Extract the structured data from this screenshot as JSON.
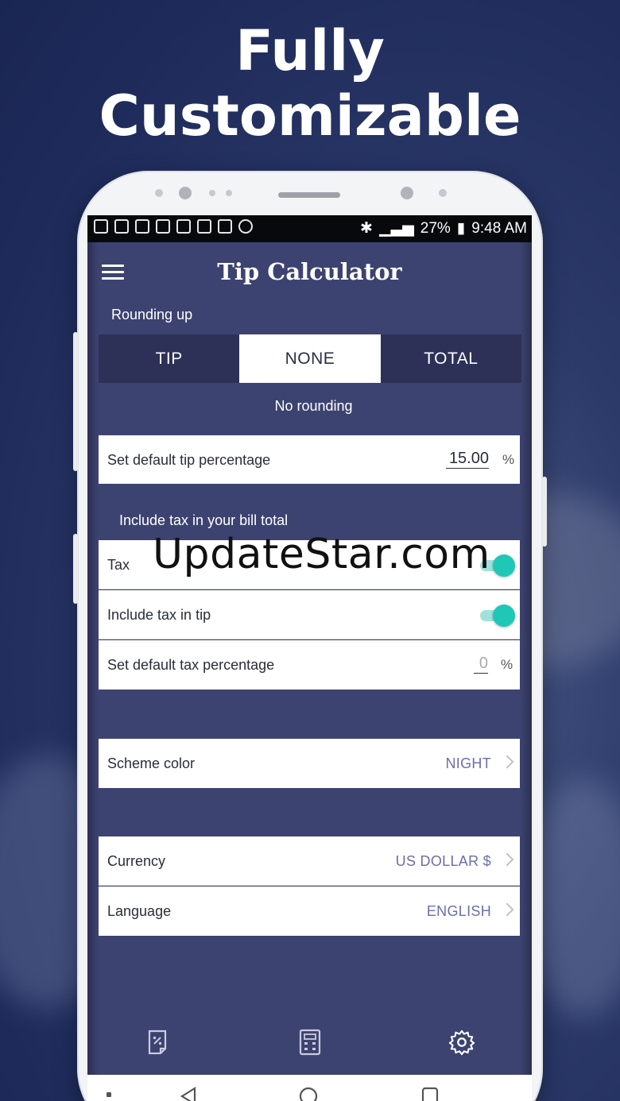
{
  "promo": {
    "headline_line1": "Fully",
    "headline_line2": "Customizable"
  },
  "status_bar": {
    "battery": "27%",
    "time": "9:48 AM"
  },
  "app": {
    "title": "Tip Calculator"
  },
  "rounding": {
    "section_label": "Rounding up",
    "options": [
      "TIP",
      "NONE",
      "TOTAL"
    ],
    "selected": "NONE",
    "note": "No rounding"
  },
  "tip": {
    "label": "Set default tip percentage",
    "value": "15.00",
    "unit": "%"
  },
  "tax_section": {
    "section_label": "Include tax in your bill total",
    "tax_label": "Tax",
    "tax_enabled": true,
    "include_in_tip_label": "Include tax in tip",
    "include_in_tip_enabled": true,
    "default_tax_label": "Set default tax percentage",
    "default_tax_value": "0",
    "unit": "%"
  },
  "scheme": {
    "label": "Scheme color",
    "value": "NIGHT"
  },
  "currency": {
    "label": "Currency",
    "value": "US DOLLAR $"
  },
  "language": {
    "label": "Language",
    "value": "ENGLISH"
  },
  "watermark": "UpdateStar.com",
  "bottom_nav": {
    "items": [
      "receipt-percent-icon",
      "calculator-icon",
      "settings-gear-icon"
    ],
    "active": "settings-gear-icon"
  },
  "colors": {
    "screen_bg": "#3d4370",
    "accent_toggle": "#1fc7b6",
    "value_text": "#6a6fa8"
  }
}
